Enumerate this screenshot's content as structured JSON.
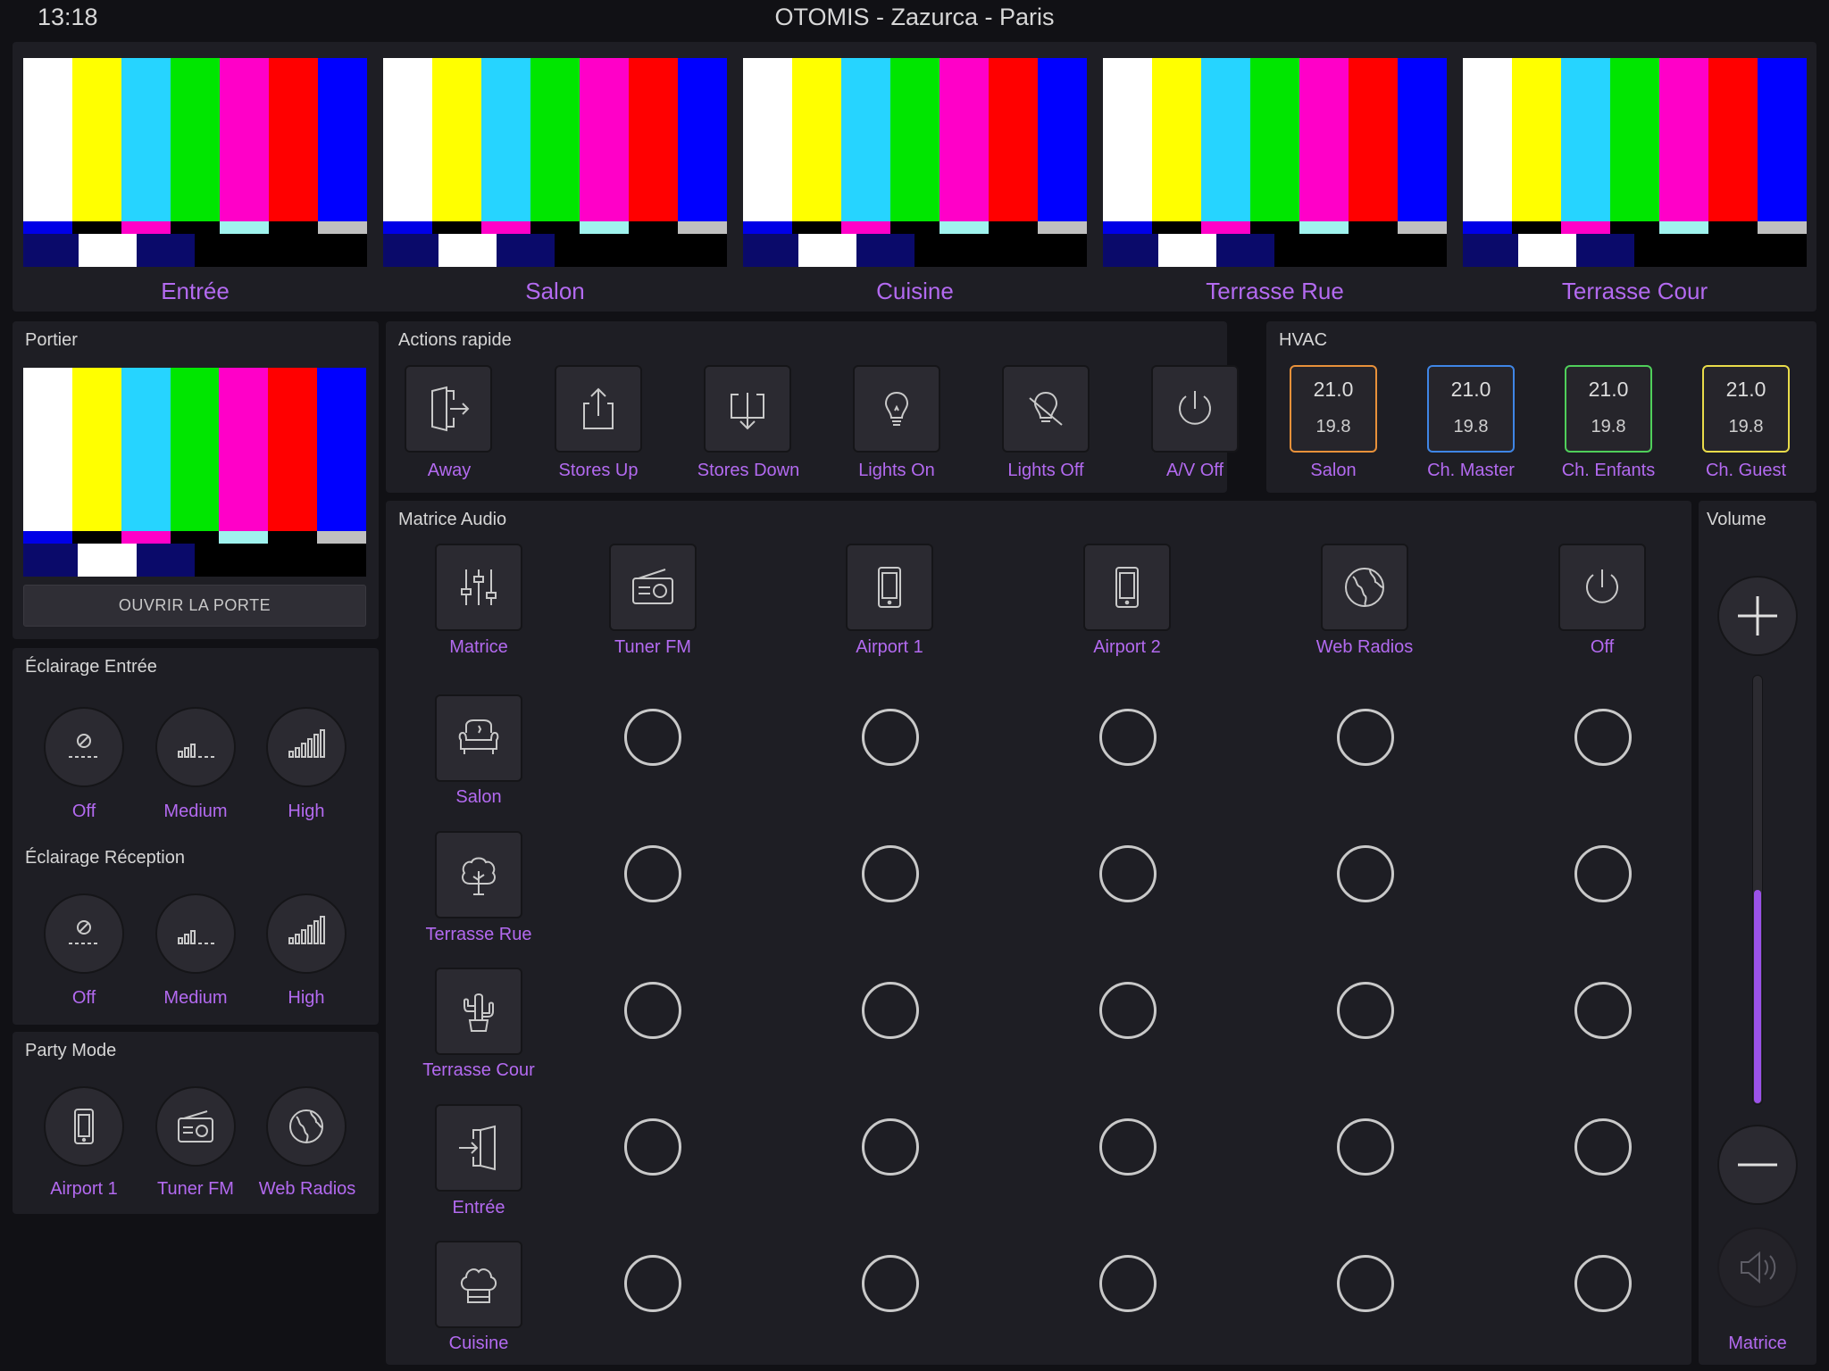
{
  "status_bar": {
    "time": "13:18",
    "title": "OTOMIS - Zazurca - Paris"
  },
  "cameras": [
    {
      "label": "Entrée"
    },
    {
      "label": "Salon"
    },
    {
      "label": "Cuisine"
    },
    {
      "label": "Terrasse Rue"
    },
    {
      "label": "Terrasse Cour"
    }
  ],
  "portier": {
    "title": "Portier",
    "button": "OUVRIR LA PORTE"
  },
  "quick_actions": {
    "title": "Actions rapide",
    "items": [
      {
        "label": "Away",
        "icon": "door-exit-icon"
      },
      {
        "label": "Stores Up",
        "icon": "upload-icon"
      },
      {
        "label": "Stores Down",
        "icon": "download-icon"
      },
      {
        "label": "Lights On",
        "icon": "bulb-icon"
      },
      {
        "label": "Lights Off",
        "icon": "bulb-off-icon"
      },
      {
        "label": "A/V Off",
        "icon": "power-icon"
      }
    ]
  },
  "hvac": {
    "title": "HVAC",
    "zones": [
      {
        "label": "Salon",
        "setpoint": "21.0",
        "current": "19.8",
        "color": "#e8913a"
      },
      {
        "label": "Ch. Master",
        "setpoint": "21.0",
        "current": "19.8",
        "color": "#3f86e6"
      },
      {
        "label": "Ch. Enfants",
        "setpoint": "21.0",
        "current": "19.8",
        "color": "#4fcf5a"
      },
      {
        "label": "Ch. Guest",
        "setpoint": "21.0",
        "current": "19.8",
        "color": "#e9dc4a"
      }
    ]
  },
  "lighting_entree": {
    "title": "Éclairage Entrée",
    "buttons": [
      {
        "label": "Off"
      },
      {
        "label": "Medium"
      },
      {
        "label": "High"
      }
    ]
  },
  "lighting_reception": {
    "title": "Éclairage Réception",
    "buttons": [
      {
        "label": "Off"
      },
      {
        "label": "Medium"
      },
      {
        "label": "High"
      }
    ]
  },
  "party_mode": {
    "title": "Party Mode",
    "buttons": [
      {
        "label": "Airport 1"
      },
      {
        "label": "Tuner FM"
      },
      {
        "label": "Web Radios"
      }
    ]
  },
  "audio_matrix": {
    "title": "Matrice Audio",
    "corner_label": "Matrice",
    "sources": [
      {
        "label": "Tuner FM",
        "icon": "radio-icon"
      },
      {
        "label": "Airport 1",
        "icon": "phone-icon"
      },
      {
        "label": "Airport 2",
        "icon": "phone-icon"
      },
      {
        "label": "Web Radios",
        "icon": "globe-icon"
      },
      {
        "label": "Off",
        "icon": "power-icon"
      }
    ],
    "zones": [
      {
        "label": "Salon",
        "icon": "armchair-icon"
      },
      {
        "label": "Terrasse Rue",
        "icon": "tree-icon"
      },
      {
        "label": "Terrasse Cour",
        "icon": "cactus-icon"
      },
      {
        "label": "Entrée",
        "icon": "door-enter-icon"
      },
      {
        "label": "Cuisine",
        "icon": "chef-hat-icon"
      }
    ]
  },
  "volume": {
    "title": "Volume",
    "level_fraction": 0.5,
    "zone_label": "Matrice"
  },
  "colors": {
    "accent": "#b36af0",
    "panel": "#1e1e24",
    "background": "#111115",
    "volume_fill": "#9b52e8"
  }
}
